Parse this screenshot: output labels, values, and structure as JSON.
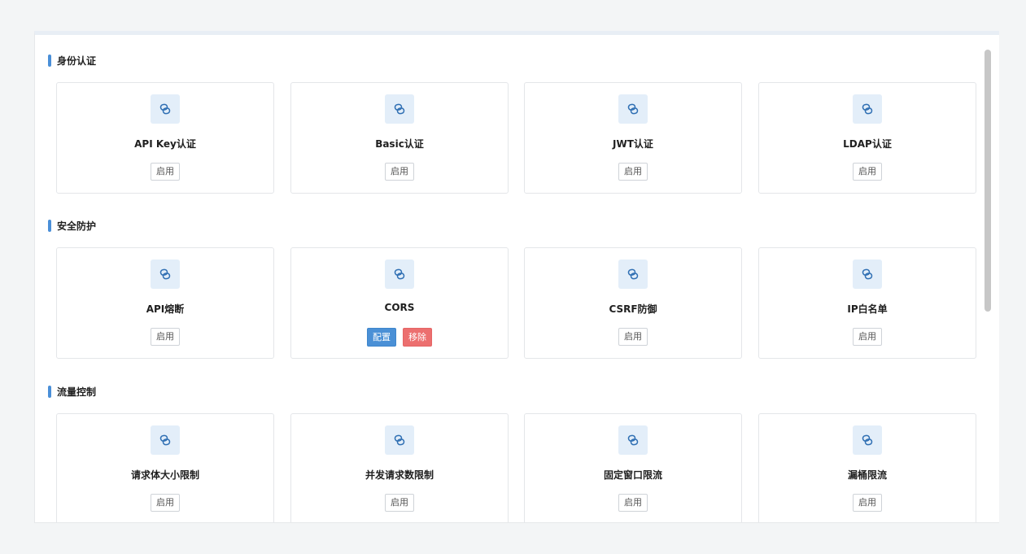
{
  "sections": [
    {
      "title": "身份认证",
      "cards": [
        {
          "name": "API Key认证",
          "buttons": [
            "启用"
          ]
        },
        {
          "name": "Basic认证",
          "buttons": [
            "启用"
          ]
        },
        {
          "name": "JWT认证",
          "buttons": [
            "启用"
          ]
        },
        {
          "name": "LDAP认证",
          "buttons": [
            "启用"
          ]
        }
      ]
    },
    {
      "title": "安全防护",
      "cards": [
        {
          "name": "API熔断",
          "buttons": [
            "启用"
          ]
        },
        {
          "name": "CORS",
          "buttons": [
            "配置",
            "移除"
          ]
        },
        {
          "name": "CSRF防御",
          "buttons": [
            "启用"
          ]
        },
        {
          "name": "IP白名单",
          "buttons": [
            "启用"
          ]
        }
      ]
    },
    {
      "title": "流量控制",
      "cards": [
        {
          "name": "请求体大小限制",
          "buttons": [
            "启用"
          ]
        },
        {
          "name": "并发请求数限制",
          "buttons": [
            "启用"
          ]
        },
        {
          "name": "固定窗口限流",
          "buttons": [
            "启用"
          ]
        },
        {
          "name": "漏桶限流",
          "buttons": [
            "启用"
          ]
        }
      ]
    }
  ],
  "icon": "link-icon",
  "colors": {
    "accent": "#4a8fd8",
    "icon_bg": "#e3eef9",
    "config_button": "#4a90d6",
    "remove_button": "#ec6f6f"
  }
}
